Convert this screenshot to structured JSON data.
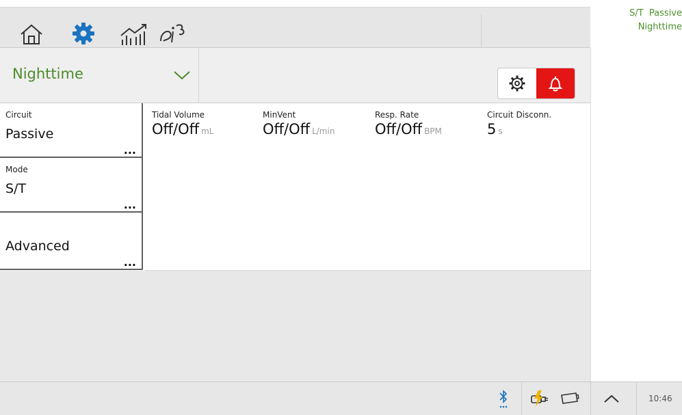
{
  "status": {
    "mode": "S/T",
    "circuit": "Passive",
    "profile": "Nighttime"
  },
  "nav": {
    "tabs": [
      {
        "name": "home",
        "icon": "home-icon"
      },
      {
        "name": "settings",
        "icon": "gear-icon",
        "active": true
      },
      {
        "name": "monitoring",
        "icon": "trend-chart-icon"
      },
      {
        "name": "tools",
        "icon": "tools-icon"
      }
    ]
  },
  "profile_selector": {
    "value": "Nighttime"
  },
  "side_menu": [
    {
      "caption": "Circuit",
      "value": "Passive",
      "more": "..."
    },
    {
      "caption": "Mode",
      "value": "S/T",
      "more": "..."
    },
    {
      "caption": "",
      "value": "Advanced",
      "more": "..."
    }
  ],
  "params": [
    {
      "caption": "Tidal Volume",
      "value": "Off/Off",
      "unit": "mL"
    },
    {
      "caption": "MinVent",
      "value": "Off/Off",
      "unit": "L/min"
    },
    {
      "caption": "Resp. Rate",
      "value": "Off/Off",
      "unit": "BPM"
    },
    {
      "caption": "Circuit Disconn.",
      "value": "5",
      "unit": "s"
    }
  ],
  "bottom": {
    "time": "10:46"
  },
  "colors": {
    "accent_green": "#4e8a2b",
    "active_tab": "#1b73c2",
    "alarm_red": "#e41515",
    "battery_yellow": "#f0b400"
  }
}
